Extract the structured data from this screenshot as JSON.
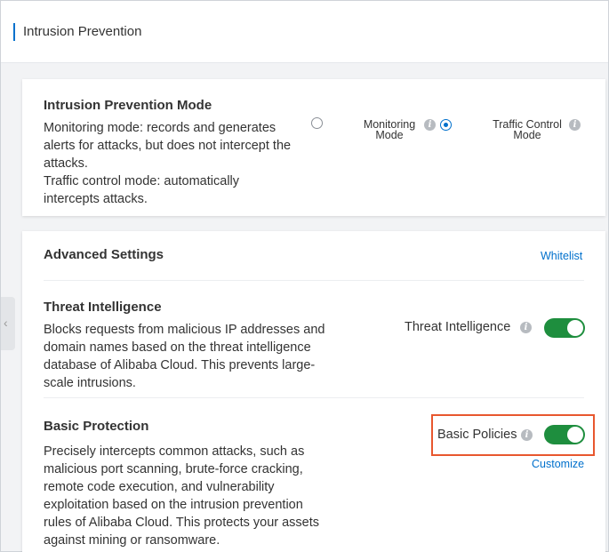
{
  "header": {
    "title": "Intrusion Prevention"
  },
  "mode_card": {
    "title": "Intrusion Prevention Mode",
    "desc_line1": "Monitoring mode: records and generates",
    "desc_line2": "alerts for attacks, but does not intercept the",
    "desc_line3": "attacks.",
    "desc_line4": "Traffic control mode: automatically",
    "desc_line5": "intercepts attacks.",
    "monitoring_label_1": "Monitoring",
    "monitoring_label_2": "Mode",
    "traffic_label_1": "Traffic Control",
    "traffic_label_2": "Mode",
    "selected": "Traffic Control Mode"
  },
  "advanced": {
    "title": "Advanced Settings",
    "whitelist_label": "Whitelist",
    "threat": {
      "title": "Threat Intelligence",
      "line1": "Blocks requests from malicious IP addresses and",
      "line2": "domain names based on the threat intelligence",
      "line3": "database of Alibaba Cloud. This prevents large-",
      "line4": "scale intrusions.",
      "switch_label": "Threat Intelligence",
      "enabled": true
    },
    "basic": {
      "title": "Basic Protection",
      "line1": "Precisely intercepts common attacks, such as",
      "line2": "malicious port scanning, brute-force cracking,",
      "line3": "remote code execution, and vulnerability",
      "line4": "exploitation based on the intrusion prevention",
      "line5": "rules of Alibaba Cloud. This protects your assets",
      "line6": "against mining or ransomware.",
      "switch_label": "Basic Policies",
      "enabled": true,
      "customize_label": "Customize"
    }
  },
  "colors": {
    "accent": "#0070cc",
    "toggle_on": "#1e8e3e",
    "highlight": "#e8572e"
  }
}
